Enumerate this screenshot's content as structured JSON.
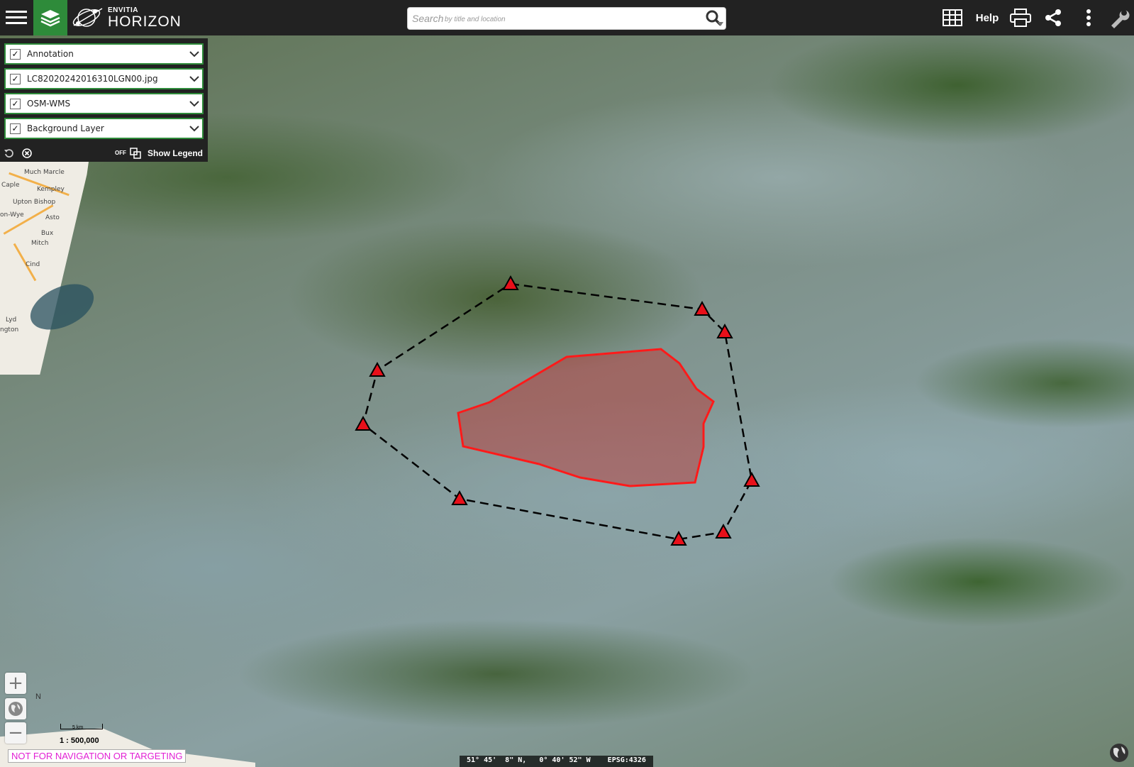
{
  "app": {
    "brand_sub": "ENVITIA",
    "brand_name": "HORIZON"
  },
  "topbar": {
    "search_placeholder": "Search",
    "search_hint": "by title and location",
    "help_label": "Help",
    "icons": [
      "menu-icon",
      "layers-icon",
      "search-icon",
      "table-icon",
      "print-icon",
      "share-icon",
      "more-vertical-icon",
      "wrench-icon"
    ]
  },
  "layers": [
    {
      "name": "Annotation",
      "checked": true
    },
    {
      "name": "LC82020242016310LGN00.jpg",
      "checked": true
    },
    {
      "name": "OSM-WMS",
      "checked": true
    },
    {
      "name": "Background Layer",
      "checked": true
    }
  ],
  "panel_tools": {
    "legend_state": "OFF",
    "show_legend_label": "Show Legend"
  },
  "map": {
    "scale_bar_label": "5 km",
    "scale_text": "1 : 500,000",
    "north_label": "N",
    "nav_warning": "NOT FOR NAVIGATION OR TARGETING",
    "coordinates": "51° 45'  8\" N,   0° 40' 52\" W    EPSG:4326",
    "osm_labels": [
      "Much Marcle",
      "Kempley",
      "Caple",
      "Upton Bishop",
      "on-Wye",
      "Asto",
      "Bux",
      "Mitch",
      "Cind",
      "Lyd",
      "ngton"
    ],
    "annotation_colors": {
      "polygon_stroke": "#ff1a1a",
      "polygon_fill": "#c0302f",
      "marker_fill": "#e8101a"
    }
  }
}
